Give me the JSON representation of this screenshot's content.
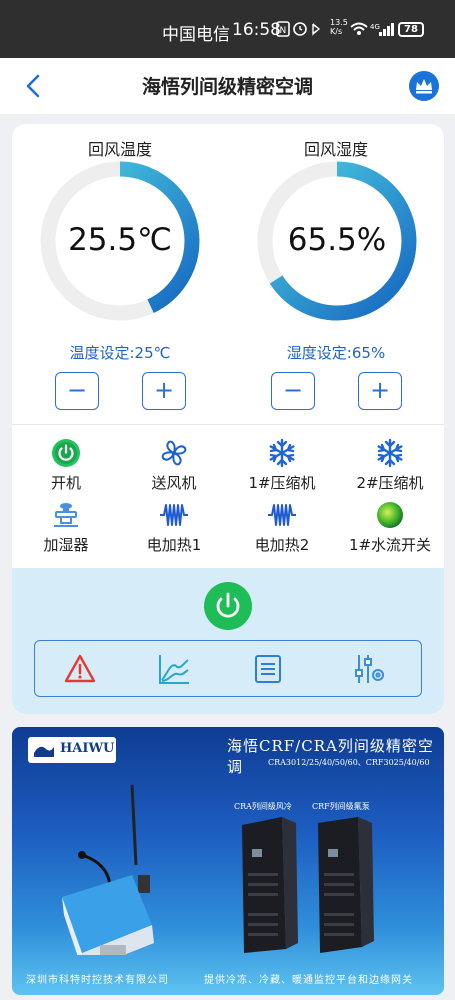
{
  "status_bar": {
    "carrier": "中国电信",
    "time": "16:58",
    "net_speed_value": "13.5",
    "net_speed_unit": "K/s",
    "battery": "78"
  },
  "header": {
    "title": "海悟列间级精密空调"
  },
  "gauges": [
    {
      "title": "回风温度",
      "value": "25.5℃",
      "fraction": 0.43,
      "setting": "温度设定:25℃"
    },
    {
      "title": "回风湿度",
      "value": "65.5%",
      "fraction": 0.66,
      "setting": "湿度设定:65%"
    }
  ],
  "stepper": {
    "minus": "−",
    "plus": "+"
  },
  "devices": [
    {
      "label": "开机",
      "icon": "power-on-icon"
    },
    {
      "label": "送风机",
      "icon": "fan-icon"
    },
    {
      "label": "1#压缩机",
      "icon": "snowflake-icon"
    },
    {
      "label": "2#压缩机",
      "icon": "snowflake-icon"
    },
    {
      "label": "加湿器",
      "icon": "humidifier-icon"
    },
    {
      "label": "电加热1",
      "icon": "heater-icon"
    },
    {
      "label": "电加热2",
      "icon": "heater-icon"
    },
    {
      "label": "1#水流开关",
      "icon": "water-flow-status-icon"
    }
  ],
  "toolbar": [
    "alarm-icon",
    "chart-icon",
    "list-icon",
    "settings-sliders-icon"
  ],
  "banner": {
    "logo": "HAIWU",
    "title": "海悟CRF/CRA列间级精密空调",
    "models": "CRA3012/25/40/50/60、CRF3025/40/60",
    "label_left": "CRA列间级风冷",
    "label_right": "CRF列间级氟泵",
    "footer_left": "深圳市科特时控技术有限公司",
    "footer_right": "提供冷冻、冷藏、暖通监控平台和边缘网关"
  },
  "colors": {
    "accent": "#1f63c9",
    "gauge_track": "#eeeeee",
    "gauge_start": "#1565c0",
    "gauge_end": "#4dd0e1",
    "power_green": "#1fbd58",
    "panel_bg": "#d6ecf8"
  }
}
